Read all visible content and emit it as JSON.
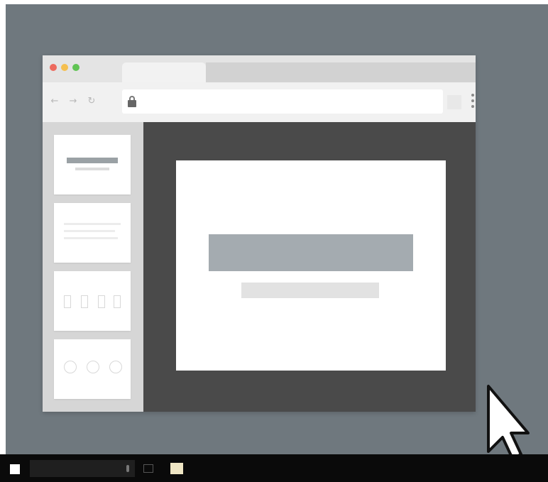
{
  "colors": {
    "desktop_bg": "#6f787e",
    "browser_chrome": "#e4e4e4",
    "address_bar": "#ffffff",
    "sidebar_bg": "#d6d6d6",
    "editor_bg": "#4a4a4a",
    "slide_bg": "#ffffff",
    "slide_title_placeholder": "#a4abb0",
    "slide_subtitle_placeholder": "#e2e2e2",
    "taskbar_bg": "#0a0a0a",
    "traffic_close": "#ed6a5e",
    "traffic_minimize": "#f5bf4f",
    "traffic_zoom": "#61c454"
  },
  "browser": {
    "icons": {
      "back": "arrow-left-icon",
      "forward": "arrow-right-icon",
      "reload": "reload-icon",
      "secure": "lock-icon",
      "menu": "kebab-menu-icon"
    },
    "back_glyph": "←",
    "forward_glyph": "→",
    "reload_glyph": "↻"
  },
  "slides_panel": {
    "thumbnails": [
      {
        "layout": "title"
      },
      {
        "layout": "text"
      },
      {
        "layout": "columns"
      },
      {
        "layout": "circles"
      }
    ]
  },
  "editor": {
    "current_slide_layout": "title"
  },
  "taskbar": {
    "icons": {
      "start": "windows-start-icon",
      "search": "search-box",
      "mic": "microphone-icon",
      "task_view": "task-view-icon",
      "explorer": "file-explorer-icon"
    }
  },
  "cursor": {
    "icon": "mouse-pointer-icon"
  }
}
